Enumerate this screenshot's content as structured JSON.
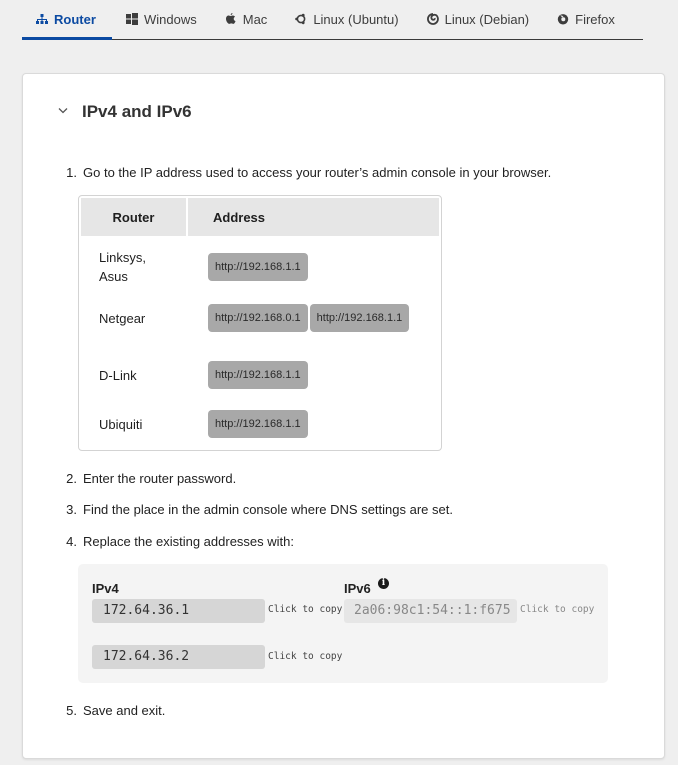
{
  "tabs": [
    {
      "label": "Router",
      "icon": "sitemap-icon",
      "active": true
    },
    {
      "label": "Windows",
      "icon": "windows-icon",
      "active": false
    },
    {
      "label": "Mac",
      "icon": "apple-icon",
      "active": false
    },
    {
      "label": "Linux (Ubuntu)",
      "icon": "ubuntu-icon",
      "active": false
    },
    {
      "label": "Linux (Debian)",
      "icon": "debian-icon",
      "active": false
    },
    {
      "label": "Firefox",
      "icon": "firefox-icon",
      "active": false
    }
  ],
  "colors": {
    "accent": "#0b4aa2"
  },
  "section": {
    "title": "IPv4 and IPv6",
    "steps": [
      {
        "num": "1.",
        "text": "Go to the IP address used to access your router’s admin console in your browser."
      },
      {
        "num": "2.",
        "text": "Enter the router password."
      },
      {
        "num": "3.",
        "text": "Find the place in the admin console where DNS settings are set."
      },
      {
        "num": "4.",
        "text": "Replace the existing addresses with:"
      },
      {
        "num": "5.",
        "text": "Save and exit."
      }
    ],
    "router_table": {
      "headers": [
        "Router",
        "Address"
      ],
      "rows": [
        {
          "router": "Linksys, Asus",
          "addresses": [
            "http://192.168.1.1"
          ]
        },
        {
          "router": "Netgear",
          "addresses": [
            "http://192.168.0.1",
            "http://192.168.1.1"
          ]
        },
        {
          "router": "D-Link",
          "addresses": [
            "http://192.168.1.1"
          ]
        },
        {
          "router": "Ubiquiti",
          "addresses": [
            "http://192.168.1.1"
          ]
        }
      ]
    },
    "dns": {
      "ipv4_label": "IPv4",
      "ipv6_label": "IPv6",
      "ipv4": [
        "172.64.36.1",
        "172.64.36.2"
      ],
      "ipv6": [
        "2a06:98c1:54::1:f675"
      ],
      "copy_label": "Click to copy",
      "info_icon": "info-icon"
    }
  }
}
